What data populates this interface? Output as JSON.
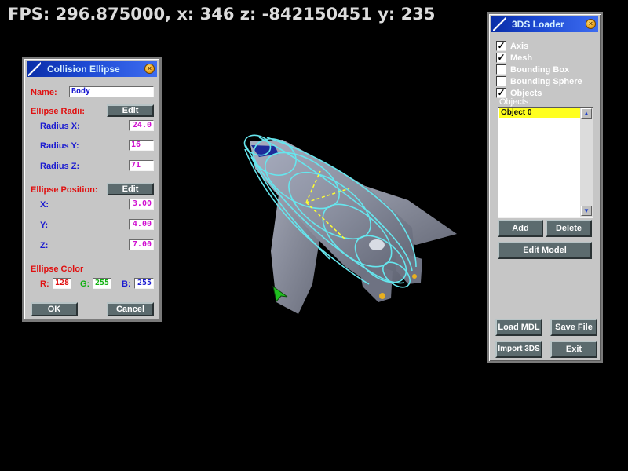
{
  "hud": {
    "text": "FPS: 296.875000, x: 346 z: -842150451 y: 235"
  },
  "collision_panel": {
    "title": "Collision Ellipse",
    "name_label": "Name:",
    "name_value": "Body",
    "radii_label": "Ellipse Radii:",
    "radii_edit": "Edit",
    "radius_x_label": "Radius X:",
    "radius_x_value": "24.0",
    "radius_y_label": "Radius Y:",
    "radius_y_value": "16",
    "radius_z_label": "Radius Z:",
    "radius_z_value": "71",
    "position_label": "Ellipse Position:",
    "position_edit": "Edit",
    "x_label": "X:",
    "x_value": "3.00",
    "y_label": "Y:",
    "y_value": "4.00",
    "z_label": "Z:",
    "z_value": "7.00",
    "color_label": "Ellipse Color",
    "r_label": "R:",
    "r_value": "128",
    "g_label": "G:",
    "g_value": "255",
    "b_label": "B:",
    "b_value": "255",
    "ok": "OK",
    "cancel": "Cancel"
  },
  "loader_panel": {
    "title": "3DS Loader",
    "options": [
      {
        "label": "Axis",
        "checked": true
      },
      {
        "label": "Mesh",
        "checked": true
      },
      {
        "label": "Bounding Box",
        "checked": false
      },
      {
        "label": "Bounding Sphere",
        "checked": false
      },
      {
        "label": "Objects",
        "checked": true
      }
    ],
    "objects_label": "Objects:",
    "objects": [
      "Object 0"
    ],
    "add": "Add",
    "delete": "Delete",
    "edit_model": "Edit Model",
    "load_mdl": "Load MDL",
    "save_file": "Save File",
    "import_3ds": "Import 3DS",
    "exit": "Exit"
  },
  "colors": {
    "background": "#000000",
    "panel": "#c6c6c6",
    "titlebar": "#1d4ad3",
    "button": "#5c6b6e",
    "wireframe": "#66e6ee",
    "selection": "#ffff20",
    "hull": "#8c93a6"
  },
  "icons": [
    "close-icon",
    "window-slash-icon",
    "checkmark-icon",
    "scroll-up-icon",
    "scroll-down-icon",
    "cursor-arrow-icon"
  ]
}
